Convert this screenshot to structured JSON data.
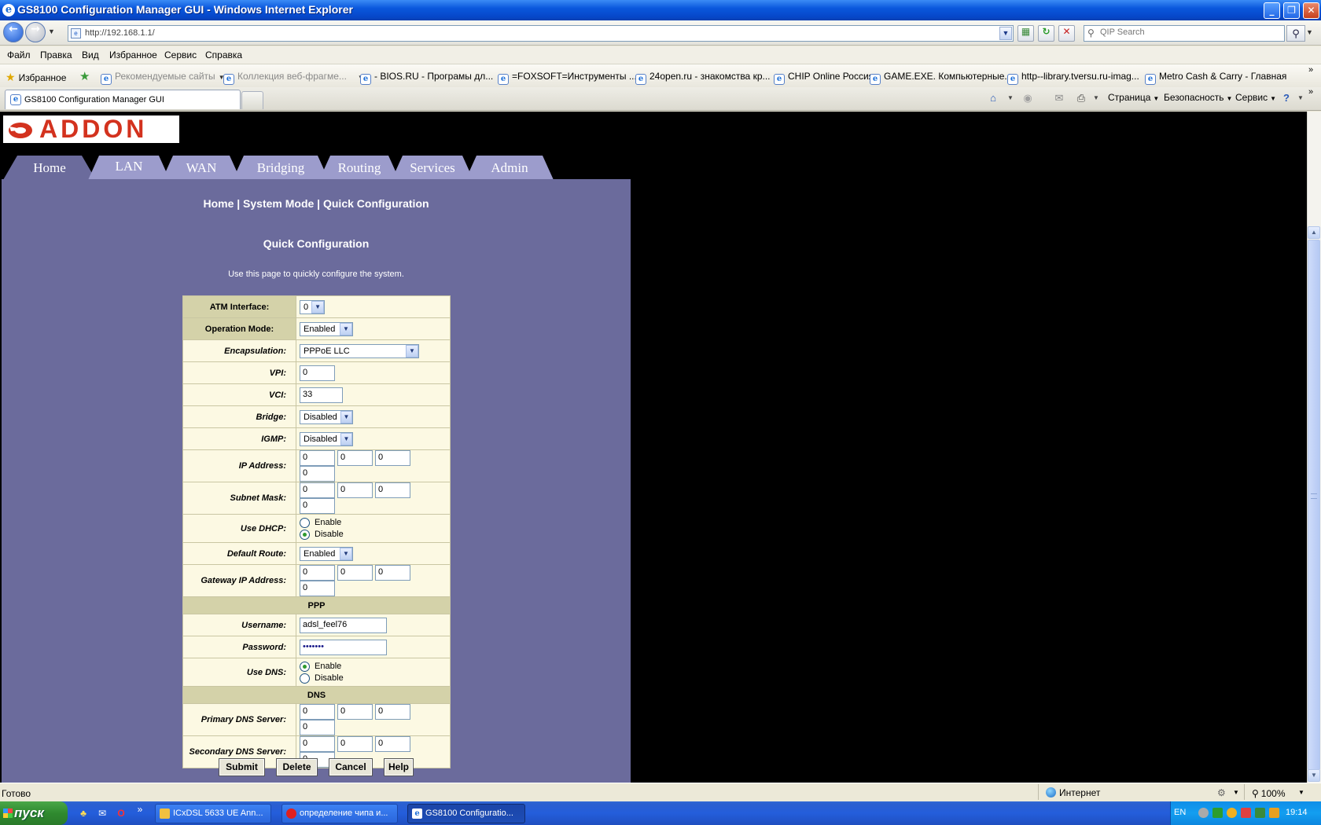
{
  "window": {
    "title": "GS8100 Configuration Manager GUI - Windows Internet Explorer",
    "minimize": "_",
    "maximize": "❐",
    "close": "✕"
  },
  "address": {
    "url": "http://192.168.1.1/",
    "search_placeholder": "QIP Search"
  },
  "menu": [
    "Файл",
    "Правка",
    "Вид",
    "Избранное",
    "Сервис",
    "Справка"
  ],
  "favorites_bar": {
    "favorites_label": "Избранное",
    "links": [
      {
        "label": "Рекомендуемые сайты",
        "dim": true
      },
      {
        "label": "Коллекция веб-фрагме...",
        "dim": true
      },
      {
        "label": "- BIOS.RU - Програмы дл..."
      },
      {
        "label": "=FOXSOFT=Инструменты ..."
      },
      {
        "label": "24open.ru - знакомства кр..."
      },
      {
        "label": "CHIP Online Россия"
      },
      {
        "label": "GAME.EXE. Компьютерные..."
      },
      {
        "label": "http--library.tversu.ru-imag..."
      },
      {
        "label": "Metro Cash & Carry - Главная"
      }
    ]
  },
  "tabs": {
    "active_tab": "GS8100 Configuration Manager GUI",
    "commands": [
      "Страница",
      "Безопасность",
      "Сервис"
    ]
  },
  "router": {
    "logo": "ADDON",
    "nav_tabs": [
      "Home",
      "LAN",
      "WAN",
      "Bridging",
      "Routing",
      "Services",
      "Admin"
    ],
    "active_tab": "Home",
    "breadcrumb": "Home | System Mode | Quick Configuration",
    "heading": "Quick Configuration",
    "description": "Use this page to quickly configure the system.",
    "fields": {
      "atm_interface": {
        "label": "ATM Interface:",
        "value": "0"
      },
      "operation_mode": {
        "label": "Operation Mode:",
        "value": "Enabled"
      },
      "encapsulation": {
        "label": "Encapsulation:",
        "value": "PPPoE LLC"
      },
      "vpi": {
        "label": "VPI:",
        "value": "0"
      },
      "vci": {
        "label": "VCI:",
        "value": "33"
      },
      "bridge": {
        "label": "Bridge:",
        "value": "Disabled"
      },
      "igmp": {
        "label": "IGMP:",
        "value": "Disabled"
      },
      "ip_address": {
        "label": "IP Address:",
        "octets": [
          "0",
          "0",
          "0",
          "0"
        ]
      },
      "subnet_mask": {
        "label": "Subnet Mask:",
        "octets": [
          "0",
          "0",
          "0",
          "0"
        ]
      },
      "use_dhcp": {
        "label": "Use DHCP:",
        "options": [
          "Enable",
          "Disable"
        ],
        "selected": "Disable"
      },
      "default_route": {
        "label": "Default Route:",
        "value": "Enabled"
      },
      "gateway_ip": {
        "label": "Gateway IP Address:",
        "octets": [
          "0",
          "0",
          "0",
          "0"
        ]
      },
      "ppp_section": "PPP",
      "username": {
        "label": "Username:",
        "value": "adsl_feel76"
      },
      "password": {
        "label": "Password:",
        "value": "•••••••"
      },
      "use_dns": {
        "label": "Use DNS:",
        "options": [
          "Enable",
          "Disable"
        ],
        "selected": "Enable"
      },
      "dns_section": "DNS",
      "primary_dns": {
        "label": "Primary DNS Server:",
        "octets": [
          "0",
          "0",
          "0",
          "0"
        ]
      },
      "secondary_dns": {
        "label": "Secondary DNS Server:",
        "octets": [
          "0",
          "0",
          "0",
          "0"
        ]
      }
    },
    "buttons": {
      "submit": "Submit",
      "delete": "Delete",
      "cancel": "Cancel",
      "help": "Help"
    }
  },
  "statusbar": {
    "status": "Готово",
    "zone": "Интернет",
    "zoom": "100%"
  },
  "taskbar": {
    "start": "пуск",
    "tasks": [
      {
        "label": "ICxDSL 5633 UE Ann..."
      },
      {
        "label": "определение чипа и..."
      },
      {
        "label": "GS8100 Configuratio..."
      }
    ],
    "lang": "EN",
    "clock": "19:14"
  },
  "colors": {
    "panel": "#6b6b9c",
    "tab_active": "#6b6b9c",
    "tab_inactive": "#9c9ccc",
    "form_bg": "#fcf9e3",
    "form_section": "#d4d2a9",
    "logo_red": "#d3321e"
  }
}
